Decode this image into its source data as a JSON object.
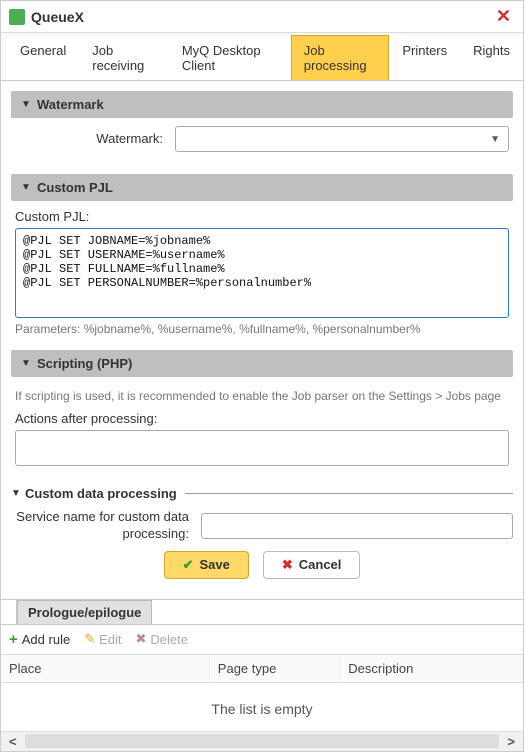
{
  "window": {
    "title": "QueueX"
  },
  "tabs": [
    "General",
    "Job receiving",
    "MyQ Desktop Client",
    "Job processing",
    "Printers",
    "Rights"
  ],
  "active_tab": "Job processing",
  "watermark": {
    "header": "Watermark",
    "label": "Watermark:",
    "value": ""
  },
  "custom_pjl": {
    "header": "Custom PJL",
    "label": "Custom PJL:",
    "value": "@PJL SET JOBNAME=%jobname%\n@PJL SET USERNAME=%username%\n@PJL SET FULLNAME=%fullname%\n@PJL SET PERSONALNUMBER=%personalnumber%",
    "hint": "Parameters: %jobname%, %username%, %fullname%, %personalnumber%"
  },
  "scripting": {
    "header": "Scripting (PHP)",
    "hint": "If scripting is used, it is recommended to enable the Job parser on the Settings > Jobs page",
    "label": "Actions after processing:",
    "value": ""
  },
  "custom_data": {
    "header": "Custom data processing",
    "label": "Service name for custom data processing:",
    "value": ""
  },
  "actions": {
    "save": "Save",
    "cancel": "Cancel"
  },
  "prologue": {
    "tab": "Prologue/epilogue",
    "toolbar": {
      "add": "Add rule",
      "edit": "Edit",
      "delete": "Delete"
    },
    "columns": [
      "Place",
      "Page type",
      "Description"
    ],
    "empty": "The list is empty"
  }
}
